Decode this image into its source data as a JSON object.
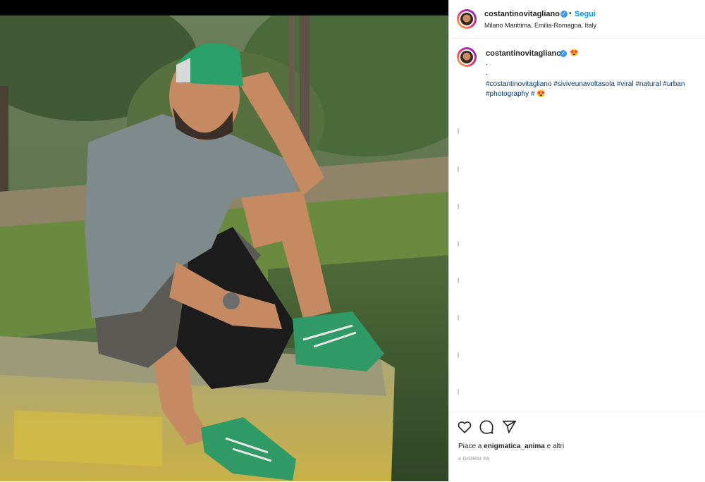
{
  "post": {
    "username": "costantinovitagliano",
    "verified_mark": "✓",
    "separator": "•",
    "follow_label": "Segui",
    "location": "Milano Marittima, Emilia-Romagna, Italy"
  },
  "caption": {
    "username": "costantinovitagliano",
    "emoji": "😍",
    "line1": ".",
    "line2": ".",
    "hashtags": [
      "#costantinovitagliano",
      "#siviveunavoltasola",
      "#viral",
      "#natural",
      "#urban",
      "#photography",
      "#"
    ],
    "end_emoji": "😍"
  },
  "actions": {
    "like_icon": "heart-icon",
    "comment_icon": "comment-icon",
    "share_icon": "send-icon",
    "likes_prefix": "Piace a ",
    "likes_user": "enigmatica_anima",
    "likes_suffix": " e altri",
    "timestamp": "4 GIORNI FA"
  },
  "colors": {
    "link": "#0095f6",
    "hashtag": "#00376b",
    "text": "#262626",
    "muted": "#8e8e8e"
  }
}
